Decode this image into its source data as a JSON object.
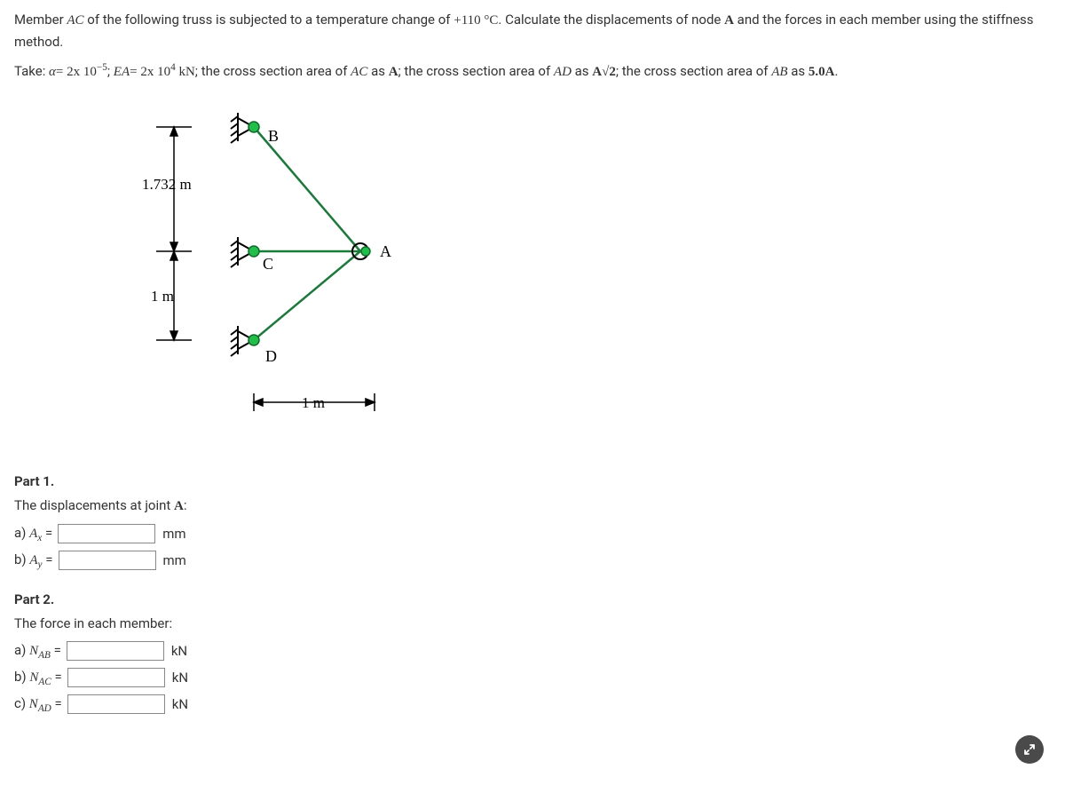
{
  "problem": {
    "line1_pre": "Member ",
    "line1_member": "AC",
    "line1_mid": " of the following truss is subjected to a temperature change of ",
    "line1_temp": "+110 °C",
    "line1_post": ". Calculate the displacements of node ",
    "line1_node": "A",
    "line1_end": " and the forces in each member using the stiffness method.",
    "line2_take": "Take: ",
    "line2_alpha_lhs": "α",
    "line2_alpha_eq": "= 2x 10",
    "line2_alpha_exp": "−5",
    "line2_sep1": "; ",
    "line2_EA_lhs": "EA",
    "line2_EA_eq": "= 2x 10",
    "line2_EA_exp": "4",
    "line2_EA_unit": " kN",
    "line2_sep2": "; the cross section area of ",
    "line2_AC": "AC",
    "line2_as1": " as ",
    "line2_A1": "A",
    "line2_sep3": "; the cross section area of ",
    "line2_AD": "AD",
    "line2_as2": " as ",
    "line2_A2": "A√2",
    "line2_sep4": "; the cross section area of ",
    "line2_AB": "AB",
    "line2_as3": " as ",
    "line2_A3": "5.0A",
    "line2_end": "."
  },
  "diagram": {
    "label_A": "A",
    "label_B": "B",
    "label_C": "C",
    "label_D": "D",
    "dim_1732": "1.732 m",
    "dim_1m_v": "1 m",
    "dim_1m_h": "1 m"
  },
  "part1": {
    "heading": "Part 1.",
    "prompt": "The displacements at joint ",
    "prompt_node": "A",
    "prompt_end": ":",
    "a_label_pre": "a) ",
    "a_var": "A",
    "a_sub": "x",
    "a_eq": " =",
    "a_unit": "mm",
    "b_label_pre": "b) ",
    "b_var": "A",
    "b_sub": "y",
    "b_eq": " =",
    "b_unit": "mm"
  },
  "part2": {
    "heading": "Part 2.",
    "prompt": "The force in each member:",
    "a_label_pre": "a) ",
    "a_var": "N",
    "a_sub": "AB",
    "a_eq": " =",
    "a_unit": "kN",
    "b_label_pre": "b) ",
    "b_var": "N",
    "b_sub": "AC",
    "b_eq": " =",
    "b_unit": "kN",
    "c_label_pre": "c) ",
    "c_var": "N",
    "c_sub": "AD",
    "c_eq": " =",
    "c_unit": "kN"
  }
}
